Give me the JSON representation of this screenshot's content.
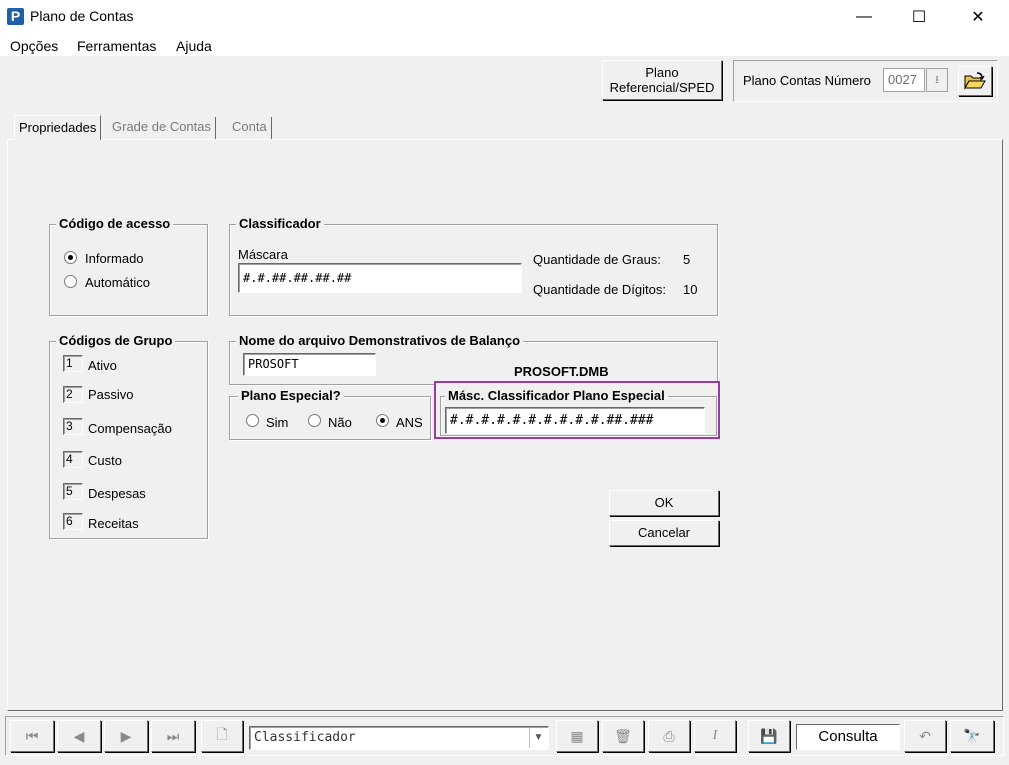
{
  "window": {
    "title": "Plano de Contas",
    "app_icon_letter": "P",
    "minimize_glyph": "—",
    "maximize_glyph": "☐",
    "close_glyph": "✕"
  },
  "menu": [
    "Opções",
    "Ferramentas",
    "Ajuda"
  ],
  "toolbar": {
    "sped_line1": "Plano",
    "sped_line2": "Referencial/SPED",
    "plano_label": "Plano Contas Número",
    "plano_number": "0027"
  },
  "tabs": [
    "Propriedades",
    "Grade de Contas",
    "Conta"
  ],
  "codigo_acesso": {
    "title": "Código de acesso",
    "options": [
      {
        "label": "Informado",
        "selected": true
      },
      {
        "label": "Automático",
        "selected": false
      }
    ]
  },
  "codigos_grupo": {
    "title": "Códigos de Grupo",
    "items": [
      {
        "code": "1",
        "label": "Ativo"
      },
      {
        "code": "2",
        "label": "Passivo"
      },
      {
        "code": "3",
        "label": "Compensação"
      },
      {
        "code": "4",
        "label": "Custo"
      },
      {
        "code": "5",
        "label": "Despesas"
      },
      {
        "code": "6",
        "label": "Receitas"
      }
    ]
  },
  "classificador": {
    "title": "Classificador",
    "mascara_label": "Máscara",
    "mascara_value": "#.#.##.##.##.##",
    "graus_label": "Quantidade de Graus:",
    "graus_value": "5",
    "digitos_label": "Quantidade de Dígitos:",
    "digitos_value": "10"
  },
  "demonstrativos": {
    "title": "Nome do arquivo Demonstrativos de Balanço",
    "value": "PROSOFT",
    "file_display": "PROSOFT.DMB"
  },
  "plano_especial": {
    "title": "Plano Especial?",
    "options": [
      {
        "label": "Sim",
        "selected": false
      },
      {
        "label": "Não",
        "selected": false
      },
      {
        "label": "ANS",
        "selected": true
      }
    ]
  },
  "masc_especial": {
    "title": "Másc. Classificador Plano Especial",
    "value": "#.#.#.#.#.#.#.#.#.#.##.###",
    "highlight_color": "#9b3aa6"
  },
  "buttons": {
    "ok": "OK",
    "cancel": "Cancelar"
  },
  "navbar": {
    "field": "Classificador",
    "mode": "Consulta"
  }
}
